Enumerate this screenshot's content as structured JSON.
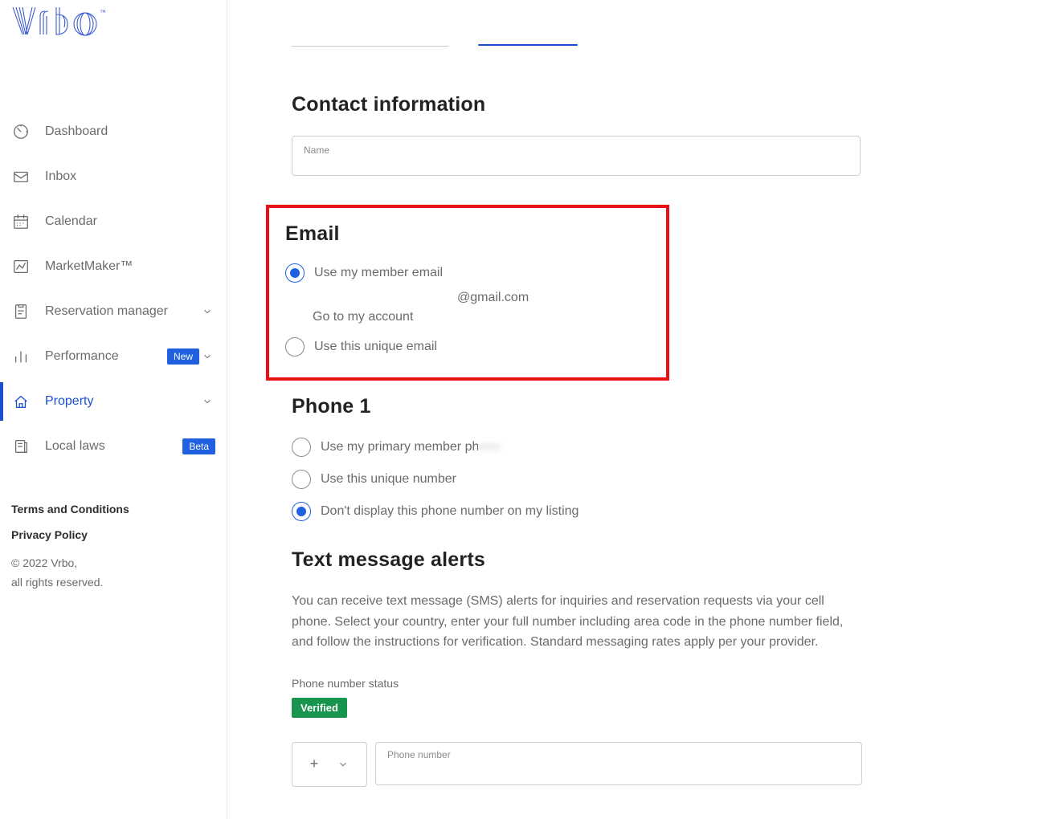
{
  "logo_alt": "Vrbo",
  "sidebar": {
    "items": [
      {
        "label": "Dashboard"
      },
      {
        "label": "Inbox"
      },
      {
        "label": "Calendar"
      },
      {
        "label": "MarketMaker™"
      },
      {
        "label": "Reservation manager"
      },
      {
        "label": "Performance",
        "badge": "New"
      },
      {
        "label": "Property"
      },
      {
        "label": "Local laws",
        "badge": "Beta"
      }
    ],
    "terms": "Terms and Conditions",
    "privacy": "Privacy Policy",
    "copyright1": "© 2022 Vrbo,",
    "copyright2": "all rights reserved."
  },
  "contact": {
    "heading": "Contact information",
    "name_label": "Name"
  },
  "email": {
    "heading": "Email",
    "opt_member": "Use my member email",
    "member_value": "@gmail.com",
    "account_link": "Go to my account",
    "opt_unique": "Use this unique email"
  },
  "phone": {
    "heading": "Phone 1",
    "opt_primary": "Use my primary member phone",
    "opt_unique": "Use this unique number",
    "opt_hide": "Don't display this phone number on my listing"
  },
  "sms": {
    "heading": "Text message alerts",
    "desc": "You can receive text message (SMS) alerts for inquiries and reservation requests via your cell phone. Select your country, enter your full number including area code in the phone number field, and follow the instructions for verification. Standard messaging rates apply per your provider.",
    "status_label": "Phone number status",
    "verified": "Verified",
    "cc_prefix": "+",
    "phone_label": "Phone number"
  }
}
